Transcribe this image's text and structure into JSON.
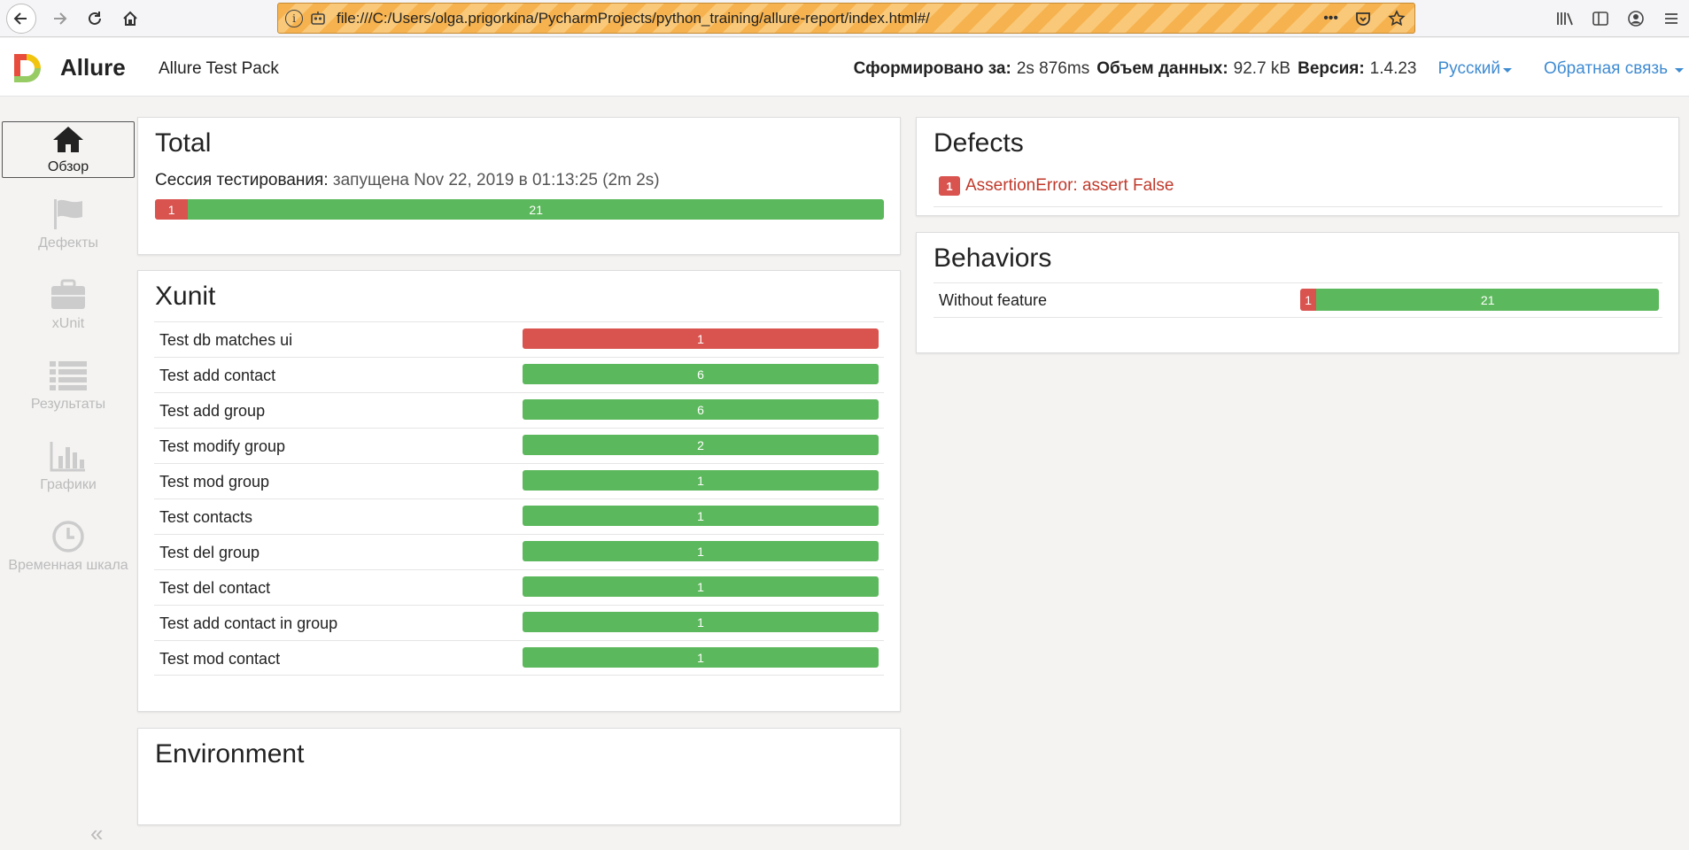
{
  "browser": {
    "url": "file:///C:/Users/olga.prigorkina/PycharmProjects/python_training/allure-report/index.html#/",
    "more": "•••"
  },
  "header": {
    "brand": "Allure",
    "report_name": "Allure Test Pack",
    "generated_label": "Сформировано за:",
    "generated_value": "2s 876ms",
    "size_label": "Объем данных:",
    "size_value": "92.7 kB",
    "version_label": "Версия:",
    "version_value": "1.4.23",
    "language": "Русский",
    "feedback": "Обратная связь"
  },
  "sidebar": {
    "items": [
      {
        "label": "Обзор",
        "icon": "home-icon"
      },
      {
        "label": "Дефекты",
        "icon": "flag-icon"
      },
      {
        "label": "xUnit",
        "icon": "briefcase-icon"
      },
      {
        "label": "Результаты",
        "icon": "list-icon"
      },
      {
        "label": "Графики",
        "icon": "bar-chart-icon"
      },
      {
        "label": "Временная шкала",
        "icon": "clock-icon"
      }
    ],
    "collapse": "«"
  },
  "total": {
    "title": "Total",
    "session_label": "Сессия тестирования:",
    "session_value": "запущена Nov 22, 2019 в 01:13:25 (2m 2s)",
    "failed": 1,
    "passed": 21,
    "failed_label": "1",
    "passed_label": "21"
  },
  "xunit": {
    "title": "Xunit",
    "rows": [
      {
        "name": "Test db matches ui",
        "failed": 1,
        "passed": 0,
        "label": "1"
      },
      {
        "name": "Test add contact",
        "failed": 0,
        "passed": 6,
        "label": "6"
      },
      {
        "name": "Test add group",
        "failed": 0,
        "passed": 6,
        "label": "6"
      },
      {
        "name": "Test modify group",
        "failed": 0,
        "passed": 2,
        "label": "2"
      },
      {
        "name": "Test mod group",
        "failed": 0,
        "passed": 1,
        "label": "1"
      },
      {
        "name": "Test contacts",
        "failed": 0,
        "passed": 1,
        "label": "1"
      },
      {
        "name": "Test del group",
        "failed": 0,
        "passed": 1,
        "label": "1"
      },
      {
        "name": "Test del contact",
        "failed": 0,
        "passed": 1,
        "label": "1"
      },
      {
        "name": "Test add contact in group",
        "failed": 0,
        "passed": 1,
        "label": "1"
      },
      {
        "name": "Test mod contact",
        "failed": 0,
        "passed": 1,
        "label": "1"
      }
    ]
  },
  "environment": {
    "title": "Environment"
  },
  "defects": {
    "title": "Defects",
    "items": [
      {
        "count": "1",
        "text": "AssertionError: assert False"
      }
    ]
  },
  "behaviors": {
    "title": "Behaviors",
    "rows": [
      {
        "name": "Without feature",
        "failed": 1,
        "passed": 21,
        "failed_label": "1",
        "passed_label": "21"
      }
    ]
  },
  "colors": {
    "failed": "#d9534f",
    "passed": "#5cb85c",
    "link": "#3f8bd2"
  }
}
